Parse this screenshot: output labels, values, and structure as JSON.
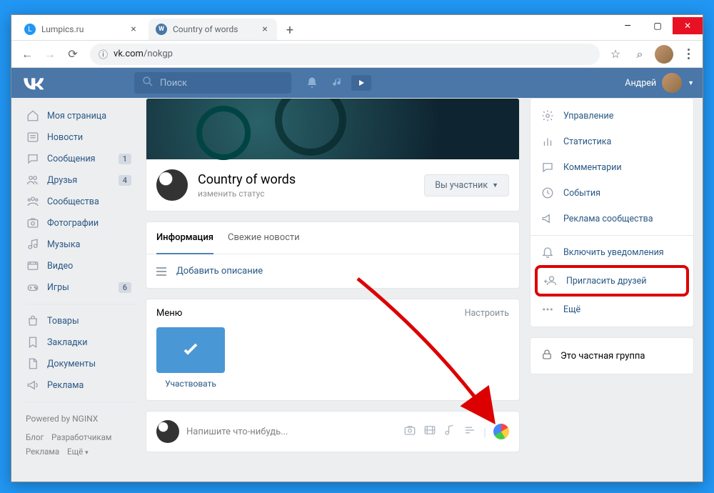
{
  "browser": {
    "tabs": [
      {
        "title": "Lumpics.ru",
        "active": false,
        "favicon_color": "#2196f3"
      },
      {
        "title": "Country of words",
        "active": true,
        "favicon_color": "#4a76a8"
      }
    ],
    "url_host": "vk.com",
    "url_path": "/nokgp"
  },
  "vk_header": {
    "search_placeholder": "Поиск",
    "username": "Андрей"
  },
  "sidebar": {
    "items": [
      {
        "label": "Моя страница",
        "icon": "home",
        "badge": null
      },
      {
        "label": "Новости",
        "icon": "news",
        "badge": null
      },
      {
        "label": "Сообщения",
        "icon": "messages",
        "badge": "1"
      },
      {
        "label": "Друзья",
        "icon": "friends",
        "badge": "4"
      },
      {
        "label": "Сообщества",
        "icon": "groups",
        "badge": null
      },
      {
        "label": "Фотографии",
        "icon": "photos",
        "badge": null
      },
      {
        "label": "Музыка",
        "icon": "music",
        "badge": null
      },
      {
        "label": "Видео",
        "icon": "video",
        "badge": null
      },
      {
        "label": "Игры",
        "icon": "games",
        "badge": "6"
      }
    ],
    "items2": [
      {
        "label": "Товары",
        "icon": "market"
      },
      {
        "label": "Закладки",
        "icon": "bookmark"
      },
      {
        "label": "Документы",
        "icon": "docs"
      },
      {
        "label": "Реклама",
        "icon": "ads"
      }
    ],
    "powered": "Powered by NGINX",
    "footer_links": [
      "Блог",
      "Разработчикам",
      "Реклама",
      "Ещё"
    ]
  },
  "group": {
    "title": "Country of words",
    "status": "изменить статус",
    "member_btn": "Вы участник",
    "tabs": [
      "Информация",
      "Свежие новости"
    ],
    "active_tab": 0,
    "add_description": "Добавить описание",
    "menu_title": "Меню",
    "menu_configure": "Настроить",
    "menu_tile_label": "Участвовать",
    "post_placeholder": "Напишите что-нибудь..."
  },
  "management": {
    "items": [
      {
        "label": "Управление",
        "icon": "gear"
      },
      {
        "label": "Статистика",
        "icon": "stats"
      },
      {
        "label": "Комментарии",
        "icon": "comments"
      },
      {
        "label": "События",
        "icon": "events"
      },
      {
        "label": "Реклама сообщества",
        "icon": "megaphone"
      }
    ],
    "items2": [
      {
        "label": "Включить уведомления",
        "icon": "bell"
      }
    ],
    "invite_label": "Пригласить друзей",
    "more_label": "Ещё"
  },
  "private_label": "Это частная группа"
}
